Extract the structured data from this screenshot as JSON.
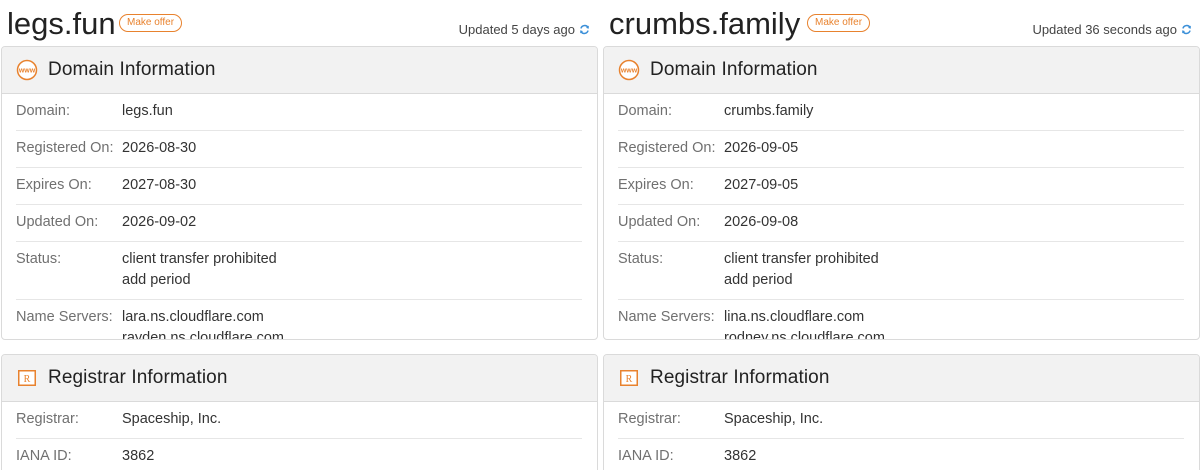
{
  "columns": [
    {
      "domain": "legs.fun",
      "make_offer": "Make offer",
      "updated": "Updated 5 days ago",
      "domain_info": {
        "title": "Domain Information",
        "rows": [
          {
            "label": "Domain:",
            "values": [
              "legs.fun"
            ]
          },
          {
            "label": "Registered On:",
            "values": [
              "2026-08-30"
            ]
          },
          {
            "label": "Expires On:",
            "values": [
              "2027-08-30"
            ]
          },
          {
            "label": "Updated On:",
            "values": [
              "2026-09-02"
            ]
          },
          {
            "label": "Status:",
            "values": [
              "client transfer prohibited",
              "add period"
            ]
          },
          {
            "label": "Name Servers:",
            "values": [
              "lara.ns.cloudflare.com",
              "rayden.ns.cloudflare.com"
            ]
          }
        ]
      },
      "registrar_info": {
        "title": "Registrar Information",
        "rows": [
          {
            "label": "Registrar:",
            "values": [
              "Spaceship, Inc."
            ]
          },
          {
            "label": "IANA ID:",
            "values": [
              "3862"
            ]
          }
        ]
      }
    },
    {
      "domain": "crumbs.family",
      "make_offer": "Make offer",
      "updated": "Updated 36 seconds ago",
      "domain_info": {
        "title": "Domain Information",
        "rows": [
          {
            "label": "Domain:",
            "values": [
              "crumbs.family"
            ]
          },
          {
            "label": "Registered On:",
            "values": [
              "2026-09-05"
            ]
          },
          {
            "label": "Expires On:",
            "values": [
              "2027-09-05"
            ]
          },
          {
            "label": "Updated On:",
            "values": [
              "2026-09-08"
            ]
          },
          {
            "label": "Status:",
            "values": [
              "client transfer prohibited",
              "add period"
            ]
          },
          {
            "label": "Name Servers:",
            "values": [
              "lina.ns.cloudflare.com",
              "rodney.ns.cloudflare.com"
            ]
          }
        ]
      },
      "registrar_info": {
        "title": "Registrar Information",
        "rows": [
          {
            "label": "Registrar:",
            "values": [
              "Spaceship, Inc."
            ]
          },
          {
            "label": "IANA ID:",
            "values": [
              "3862"
            ]
          }
        ]
      }
    }
  ],
  "icons": {
    "www": "www-icon",
    "registrar": "registrar-icon",
    "refresh": "refresh-icon"
  },
  "colors": {
    "accent": "#e8822e",
    "refresh": "#3a8fd8",
    "panel_header_bg": "#f2f2f2",
    "border": "#dadada"
  }
}
